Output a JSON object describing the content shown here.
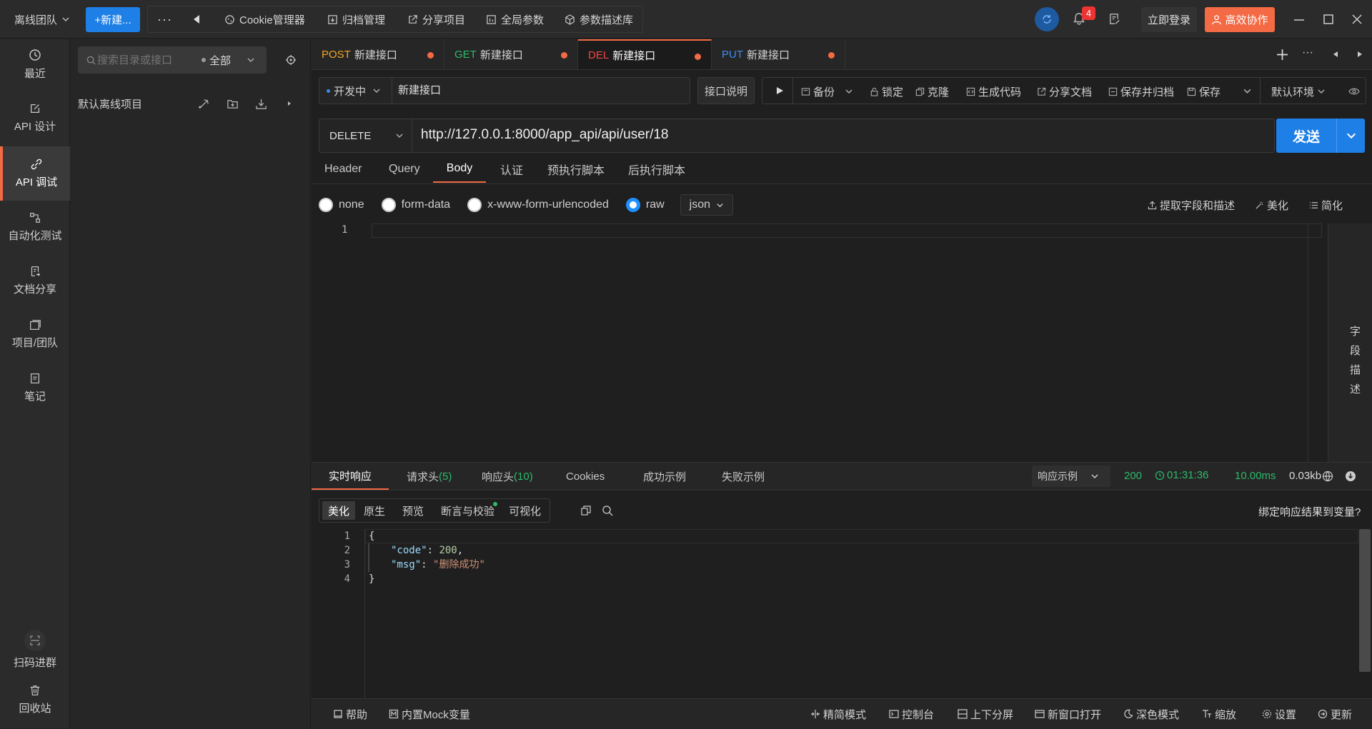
{
  "topbar": {
    "team": "离线团队",
    "new_btn": "+新建...",
    "more": "···",
    "menu": [
      "Cookie管理器",
      "归档管理",
      "分享项目",
      "全局参数",
      "参数描述库"
    ],
    "notif_count": "4",
    "login": "立即登录",
    "collab": "高效协作"
  },
  "nav": [
    {
      "label": "最近",
      "icon": "clock-icon"
    },
    {
      "label": "API 设计",
      "icon": "edit-icon"
    },
    {
      "label": "API 调试",
      "icon": "link-icon"
    },
    {
      "label": "自动化测试",
      "icon": "flow-icon"
    },
    {
      "label": "文档分享",
      "icon": "doc-share-icon"
    },
    {
      "label": "项目/团队",
      "icon": "project-icon"
    },
    {
      "label": "笔记",
      "icon": "note-icon"
    }
  ],
  "nav_bottom": {
    "qr": "扫码进群",
    "trash": "回收站"
  },
  "project": {
    "search_placeholder": "搜索目录或接口",
    "filter": "全部",
    "root": "默认离线项目"
  },
  "tabs": [
    {
      "method": "POST",
      "name": "新建接口",
      "color": "#f5a623"
    },
    {
      "method": "GET",
      "name": "新建接口",
      "color": "#2dbb6a"
    },
    {
      "method": "DEL",
      "name": "新建接口",
      "color": "#f04848"
    },
    {
      "method": "PUT",
      "name": "新建接口",
      "color": "#3a8df0"
    }
  ],
  "request": {
    "status": "开发中",
    "name": "新建接口",
    "desc_btn": "接口说明",
    "tools": [
      "备份",
      "锁定",
      "克隆",
      "生成代码",
      "分享文档",
      "保存并归档",
      "保存"
    ],
    "env": "默认环境",
    "method": "DELETE",
    "url": "http://127.0.0.1:8000/app_api/api/user/18",
    "send": "发送"
  },
  "req_tabs": [
    "Header",
    "Query",
    "Body",
    "认证",
    "预执行脚本",
    "后执行脚本"
  ],
  "body": {
    "modes": [
      "none",
      "form-data",
      "x-www-form-urlencoded",
      "raw"
    ],
    "format": "json",
    "actions": [
      "提取字段和描述",
      "美化",
      "简化"
    ],
    "line1": "1",
    "side_label": [
      "字",
      "段",
      "描",
      "述"
    ]
  },
  "response": {
    "tabs": [
      "实时响应",
      "请求头",
      "(5)",
      "响应头",
      "(10)",
      "Cookies",
      "成功示例",
      "失败示例"
    ],
    "example": "响应示例",
    "status": "200",
    "time": "01:31:36",
    "duration": "10.00ms",
    "size": "0.03kb",
    "view_tabs": [
      "美化",
      "原生",
      "预览",
      "断言与校验",
      "可视化"
    ],
    "bind": "绑定响应结果到变量?",
    "lines": [
      "1",
      "2",
      "3",
      "4"
    ],
    "code": {
      "l1": "{",
      "key1": "\"code\"",
      "val1": "200",
      "key2": "\"msg\"",
      "val2": "\"删除成功\"",
      "l4": "}"
    }
  },
  "bottom": {
    "left": [
      "帮助",
      "内置Mock变量"
    ],
    "right": [
      "精简模式",
      "控制台",
      "上下分屏",
      "新窗口打开",
      "深色模式",
      "缩放",
      "设置",
      "更新"
    ]
  }
}
